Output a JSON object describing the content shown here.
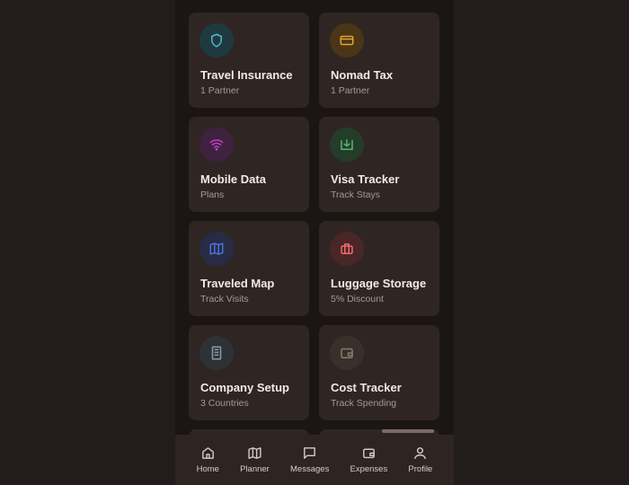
{
  "cards": [
    {
      "title": "Travel Insurance",
      "subtitle": "1 Partner",
      "icon": "shield-icon",
      "icon_color": "#4fb8c9",
      "bg_color": "#1f3a3f"
    },
    {
      "title": "Nomad Tax",
      "subtitle": "1 Partner",
      "icon": "credit-card-icon",
      "icon_color": "#e6a32e",
      "bg_color": "#4a3517"
    },
    {
      "title": "Mobile Data",
      "subtitle": "Plans",
      "icon": "wifi-icon",
      "icon_color": "#c43fc6",
      "bg_color": "#3f2140"
    },
    {
      "title": "Visa Tracker",
      "subtitle": "Track Stays",
      "icon": "download-box-icon",
      "icon_color": "#58b76a",
      "bg_color": "#233d2a"
    },
    {
      "title": "Traveled Map",
      "subtitle": "Track Visits",
      "icon": "map-icon",
      "icon_color": "#4f6fd6",
      "bg_color": "#272b45"
    },
    {
      "title": "Luggage Storage",
      "subtitle": "5% Discount",
      "icon": "luggage-icon",
      "icon_color": "#f06a6a",
      "bg_color": "#4a2626"
    },
    {
      "title": "Company Setup",
      "subtitle": "3 Countries",
      "icon": "building-icon",
      "icon_color": "#8a98a8",
      "bg_color": "#2e3236"
    },
    {
      "title": "Cost Tracker",
      "subtitle": "Track Spending",
      "icon": "wallet-icon",
      "icon_color": "#8a7a6c",
      "bg_color": "#3a302b"
    }
  ],
  "nav": [
    {
      "label": "Home",
      "icon": "home-icon"
    },
    {
      "label": "Planner",
      "icon": "map-icon"
    },
    {
      "label": "Messages",
      "icon": "message-icon"
    },
    {
      "label": "Expenses",
      "icon": "wallet-icon"
    },
    {
      "label": "Profile",
      "icon": "user-icon"
    }
  ]
}
